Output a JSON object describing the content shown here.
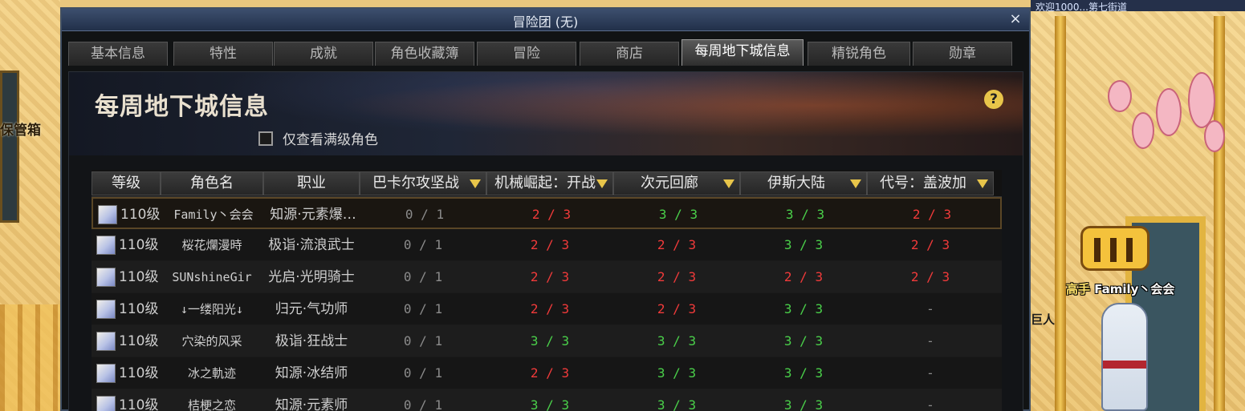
{
  "window": {
    "title": "冒险团 (无)",
    "close_glyph": "×"
  },
  "tabs": [
    {
      "label": "基本信息"
    },
    {
      "label": "特性"
    },
    {
      "label": "成就"
    },
    {
      "label": "角色收藏簿"
    },
    {
      "label": "冒险"
    },
    {
      "label": "商店"
    },
    {
      "label": "每周地下城信息",
      "active": true
    },
    {
      "label": "精锐角色"
    },
    {
      "label": "勋章"
    }
  ],
  "panel": {
    "heading": "每周地下城信息",
    "help_glyph": "?",
    "filter_label": "仅查看满级角色"
  },
  "table": {
    "headers": [
      "等级",
      "角色名",
      "职业",
      "巴卡尔攻坚战",
      "机械崛起：开战",
      "次元回廊",
      "伊斯大陆",
      "代号：盖波加"
    ],
    "rows": [
      {
        "level": "110级",
        "name": "Family丶会会",
        "job": "知源·元素爆…",
        "c1": "0 / 1",
        "c2": "2 / 3",
        "c3": "3 / 3",
        "c4": "3 / 3",
        "c5": "2 / 3"
      },
      {
        "level": "110级",
        "name": "桜花爛漫時",
        "job": "极诣·流浪武士",
        "c1": "0 / 1",
        "c2": "2 / 3",
        "c3": "2 / 3",
        "c4": "3 / 3",
        "c5": "2 / 3"
      },
      {
        "level": "110级",
        "name": "SUNshineGir",
        "job": "光启·光明骑士",
        "c1": "0 / 1",
        "c2": "2 / 3",
        "c3": "2 / 3",
        "c4": "2 / 3",
        "c5": "2 / 3"
      },
      {
        "level": "110级",
        "name": "↓一缕阳光↓",
        "job": "归元·气功师",
        "c1": "0 / 1",
        "c2": "2 / 3",
        "c3": "2 / 3",
        "c4": "3 / 3",
        "c5": "-"
      },
      {
        "level": "110级",
        "name": "穴染的风采",
        "job": "极诣·狂战士",
        "c1": "0 / 1",
        "c2": "3 / 3",
        "c3": "3 / 3",
        "c4": "3 / 3",
        "c5": "-"
      },
      {
        "level": "110级",
        "name": "冰之軌迹",
        "job": "知源·冰结师",
        "c1": "0 / 1",
        "c2": "2 / 3",
        "c3": "3 / 3",
        "c4": "3 / 3",
        "c5": "-"
      },
      {
        "level": "110级",
        "name": "桔梗之恋",
        "job": "知源·元素师",
        "c1": "0 / 1",
        "c2": "3 / 3",
        "c3": "3 / 3",
        "c4": "3 / 3",
        "c5": "-"
      }
    ]
  },
  "scene": {
    "left_sign": "保管箱",
    "topbar_text": "欢迎1000...第七街道",
    "character_rank": "高手",
    "character_name": "Family丶会会",
    "npc_label": "巨人"
  },
  "colors": {
    "incomplete": "#f03a3a",
    "complete": "#4ad04a",
    "locked": "#8b8b8b",
    "accent": "#e8c54a"
  }
}
